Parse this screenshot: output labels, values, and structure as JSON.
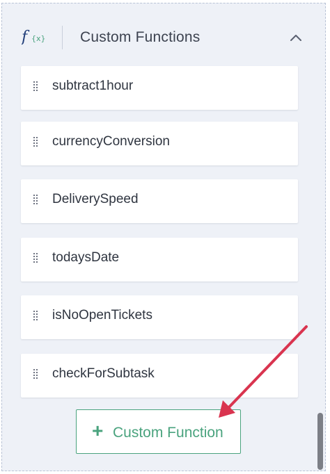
{
  "header": {
    "icon": "fx-function-icon",
    "title": "Custom Functions",
    "collapse_icon": "chevron-up-icon"
  },
  "functions": [
    {
      "label": "subtract1hour"
    },
    {
      "label": "currencyConversion"
    },
    {
      "label": "DeliverySpeed"
    },
    {
      "label": "todaysDate"
    },
    {
      "label": "isNoOpenTickets"
    },
    {
      "label": "checkForSubtask"
    }
  ],
  "add_button": {
    "icon": "plus-icon",
    "label": "Custom Function"
  },
  "colors": {
    "accent_green": "#4aa37e",
    "annotation_arrow": "#d9344f",
    "panel_bg": "#eef1f7",
    "fx_icon_blue": "#1f3c78"
  }
}
